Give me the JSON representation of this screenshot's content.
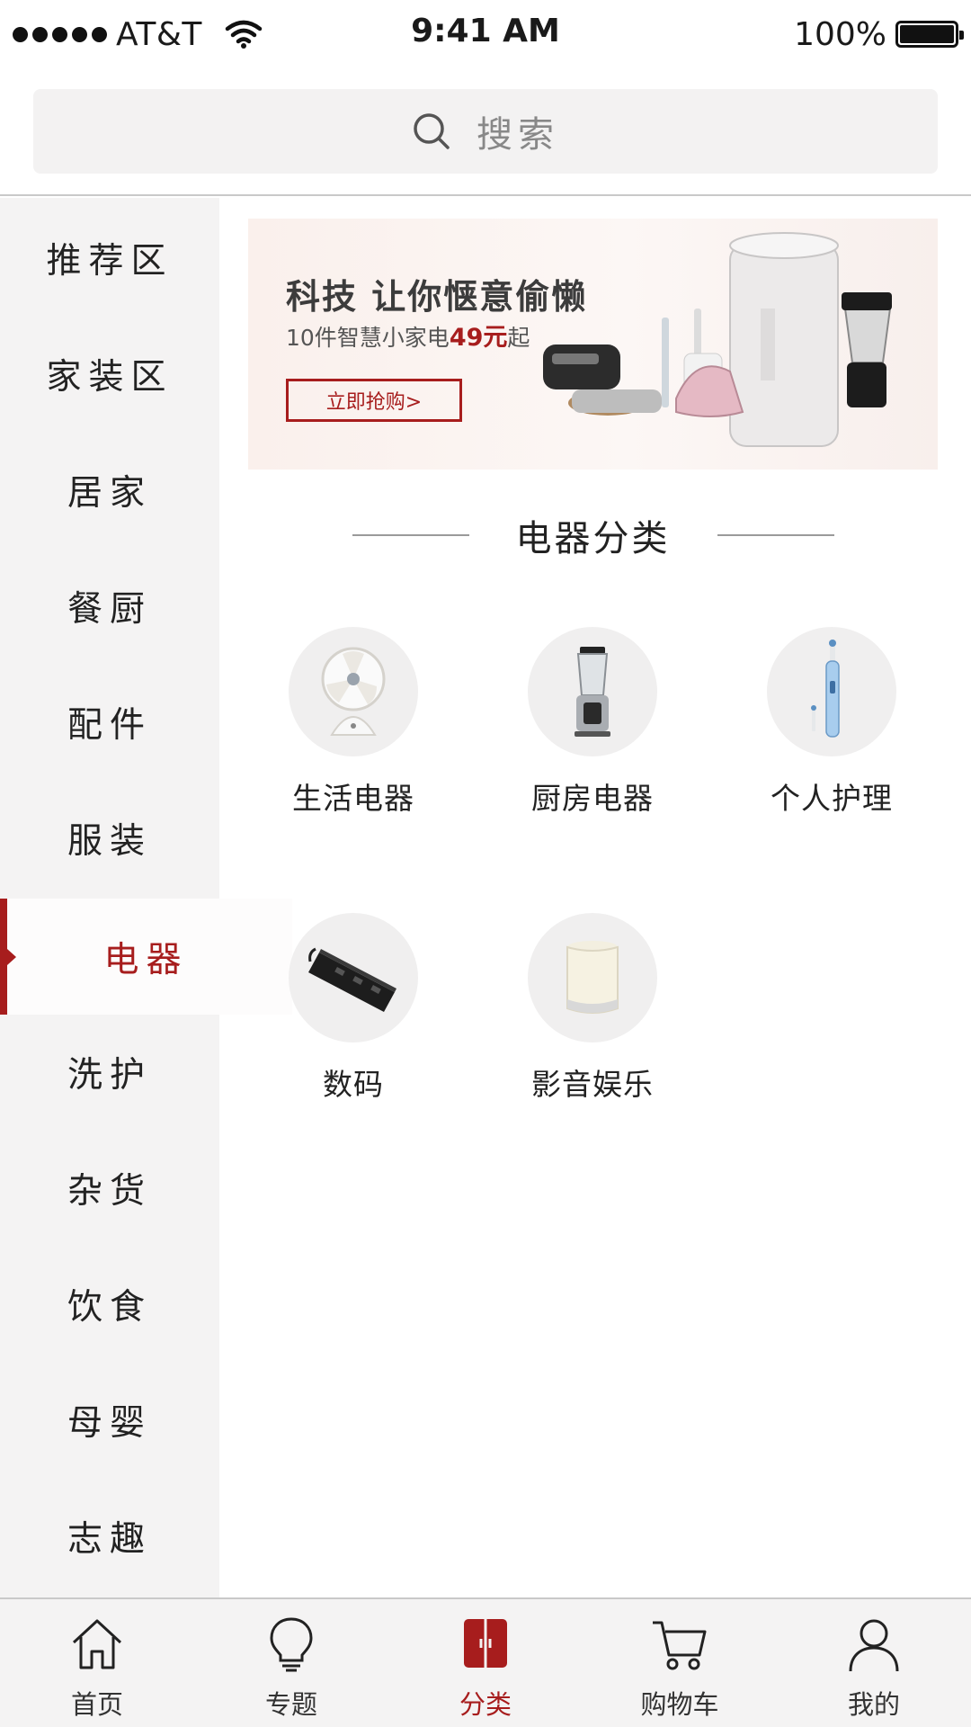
{
  "status_bar": {
    "carrier": "AT&T",
    "time": "9:41 AM",
    "battery": "100%"
  },
  "search": {
    "placeholder": "搜索"
  },
  "sidebar": {
    "items": [
      {
        "label": "推荐区"
      },
      {
        "label": "家装区"
      },
      {
        "label": "居家"
      },
      {
        "label": "餐厨"
      },
      {
        "label": "配件"
      },
      {
        "label": "服装"
      },
      {
        "label": "电器",
        "active": true
      },
      {
        "label": "洗护"
      },
      {
        "label": "杂货"
      },
      {
        "label": "饮食"
      },
      {
        "label": "母婴"
      },
      {
        "label": "志趣"
      }
    ]
  },
  "banner": {
    "title": "科技 让你惬意偷懒",
    "subtitle_prefix": "10件智慧小家电",
    "subtitle_price": "49元",
    "subtitle_suffix": "起",
    "button_label": "立即抢购>"
  },
  "section": {
    "title": "电器分类"
  },
  "categories": [
    {
      "label": "生活电器",
      "icon": "fan-icon"
    },
    {
      "label": "厨房电器",
      "icon": "blender-icon"
    },
    {
      "label": "个人护理",
      "icon": "toothbrush-icon"
    },
    {
      "label": "数码",
      "icon": "power-strip-icon"
    },
    {
      "label": "影音娱乐",
      "icon": "lamp-speaker-icon"
    }
  ],
  "tab_bar": {
    "tabs": [
      {
        "label": "首页",
        "icon": "home-icon"
      },
      {
        "label": "专题",
        "icon": "lightbulb-icon"
      },
      {
        "label": "分类",
        "icon": "category-icon",
        "active": true
      },
      {
        "label": "购物车",
        "icon": "cart-icon"
      },
      {
        "label": "我的",
        "icon": "user-icon"
      }
    ]
  },
  "colors": {
    "accent": "#a71d1d",
    "sidebar_bg": "#f4f3f3",
    "search_bg": "#f3f2f2"
  }
}
